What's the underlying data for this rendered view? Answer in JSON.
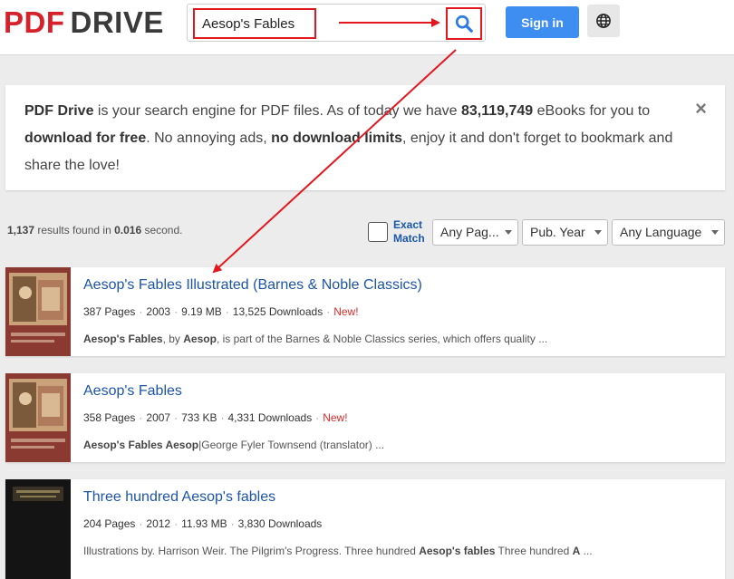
{
  "header": {
    "logo_part1": "PDF",
    "logo_part2": "DRIVE",
    "search_value": "Aesop's Fables",
    "signin_label": "Sign in"
  },
  "info": {
    "brand": "PDF Drive",
    "text1": " is your search engine for PDF files. As of today we have ",
    "count": "83,119,749",
    "text2": " eBooks for you to ",
    "free": "download for free",
    "text3": ". No annoying ads, ",
    "nolimits": "no download limits",
    "text4": ", enjoy it and don't forget to bookmark and share the love!",
    "close": "×"
  },
  "results": {
    "count": "1,137",
    "text1": " results found in ",
    "time": "0.016",
    "text2": " second."
  },
  "filters": {
    "exact_line1": "Exact",
    "exact_line2": "Match",
    "pages": "Any Pag...",
    "year": "Pub. Year",
    "language": "Any Language"
  },
  "items": [
    {
      "title": "Aesop's Fables Illustrated (Barnes & Noble Classics)",
      "pages": "387 Pages",
      "year": "2003",
      "size": "9.19 MB",
      "downloads": "13,525 Downloads",
      "new": "New!",
      "snippet_b1": "Aesop's Fables",
      "snippet_t1": ", by ",
      "snippet_b2": "Aesop",
      "snippet_t2": ", is part of the Barnes & Noble Classics series, which offers quality  ..."
    },
    {
      "title": "Aesop's Fables",
      "pages": "358 Pages",
      "year": "2007",
      "size": "733 KB",
      "downloads": "4,331 Downloads",
      "new": "New!",
      "snippet_b1": "Aesop's Fables Aesop",
      "snippet_t1": "|George Fyler Townsend (translator)  ..."
    },
    {
      "title": "Three hundred Aesop's fables",
      "pages": "204 Pages",
      "year": "2012",
      "size": "11.93 MB",
      "downloads": "3,830 Downloads",
      "snippet_t0": "Illustrations by. Harrison Weir. The Pilgrim's Progress. Three hundred ",
      "snippet_b1": "Aesop's fables",
      "snippet_t1": " Three hundred ",
      "snippet_b2": "A",
      "snippet_t2": "  ..."
    }
  ],
  "colors": {
    "brand_red": "#d6212a",
    "link_blue": "#1d54a7",
    "signin_blue": "#3d8ef0",
    "annotation_red": "#e3181f"
  }
}
